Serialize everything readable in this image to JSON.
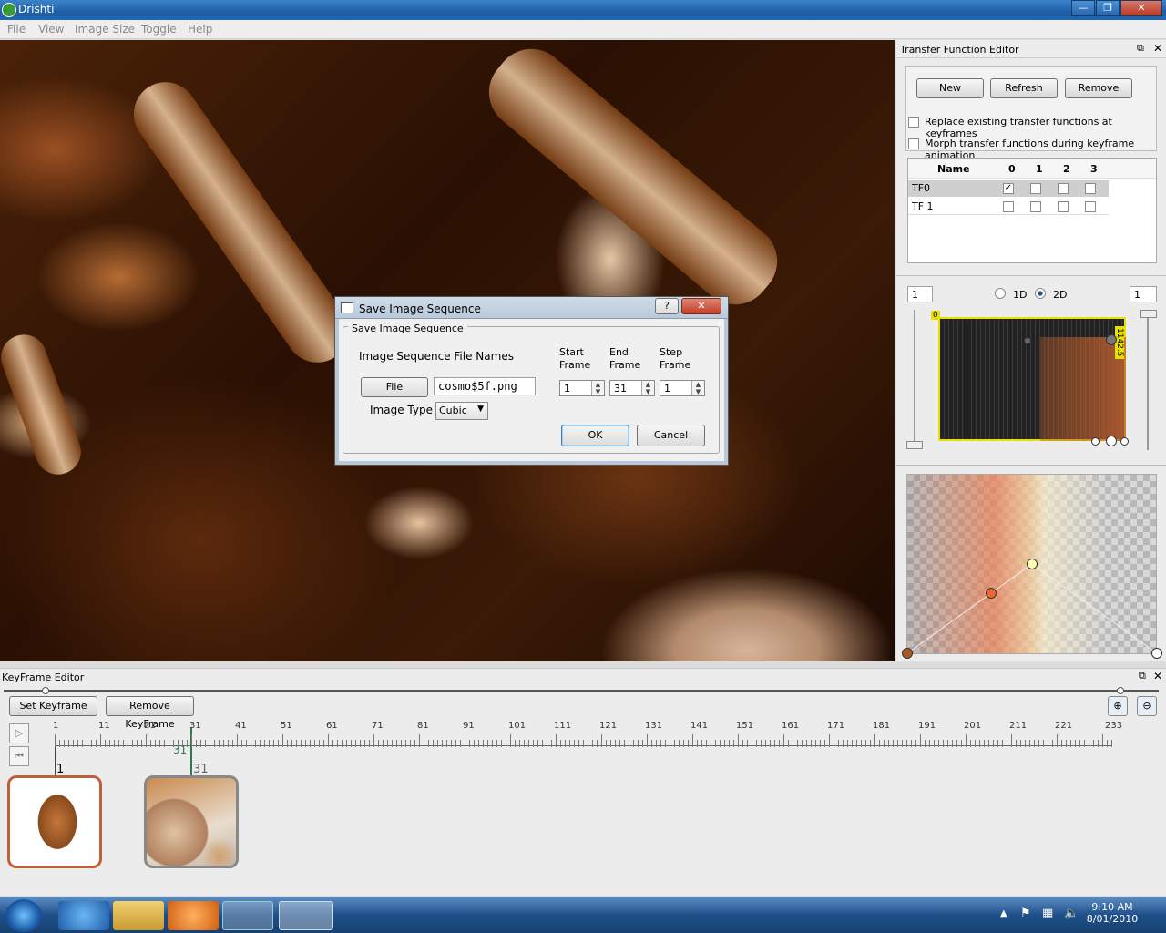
{
  "window": {
    "title": "Drishti"
  },
  "menu": [
    "File",
    "View",
    "Image Size",
    "Toggle",
    "Help"
  ],
  "dialog": {
    "title": "Save Image Sequence",
    "group_title": "Save Image Sequence",
    "file_names_label": "Image Sequence File Names",
    "file_button": "File",
    "file_value": "cosmo$5f.png",
    "image_type_label": "Image Type",
    "image_type_value": "Cubic",
    "start_label_1": "Start",
    "start_label_2": "Frame",
    "end_label_1": "End",
    "end_label_2": "Frame",
    "step_label_1": "Step",
    "step_label_2": "Frame",
    "start_value": "1",
    "end_value": "31",
    "step_value": "1",
    "ok": "OK",
    "cancel": "Cancel",
    "help": "?"
  },
  "tf_editor": {
    "title": "Transfer Function Editor",
    "new": "New",
    "refresh": "Refresh",
    "remove": "Remove",
    "replace_label": "Replace existing transfer functions at keyframes",
    "morph_label": "Morph transfer functions during keyframe animation",
    "table_headers": [
      "Name",
      "0",
      "1",
      "2",
      "3"
    ],
    "rows": [
      {
        "name": "TF0",
        "checks": [
          true,
          false,
          false,
          false
        ]
      },
      {
        "name": "TF 1",
        "checks": [
          false,
          false,
          false,
          false
        ]
      }
    ],
    "left_value": "1",
    "right_value": "1",
    "mode_1d": "1D",
    "mode_2d": "2D",
    "graph_top_left": "0",
    "graph_top_right": "1142.5"
  },
  "keyframe_editor": {
    "title": "KeyFrame Editor",
    "set_keyframe": "Set Keyframe",
    "remove_keyframe": "Remove KeyFrame",
    "ruler_labels": [
      "1",
      "11",
      "21",
      "31",
      "41",
      "51",
      "61",
      "71",
      "81",
      "91",
      "101",
      "111",
      "121",
      "131",
      "141",
      "151",
      "161",
      "171",
      "181",
      "191",
      "201",
      "211",
      "221",
      "233"
    ],
    "marker": "31",
    "frame1": "1",
    "frame2": "31"
  },
  "taskbar": {
    "time": "9:10 AM",
    "date": "8/01/2010"
  }
}
